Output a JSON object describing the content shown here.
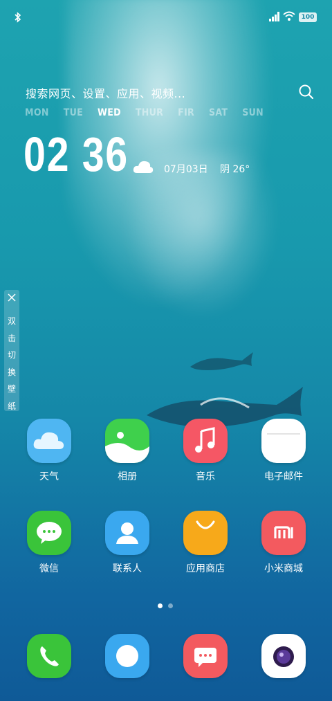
{
  "status_bar": {
    "battery": "100",
    "icons": [
      "bluetooth-icon",
      "signal-icon",
      "wifi-icon",
      "battery-icon"
    ]
  },
  "widget": {
    "search_placeholder": "搜索网页、设置、应用、视频...",
    "weekdays": [
      "MON",
      "TUE",
      "WED",
      "THUR",
      "FIR",
      "SAT",
      "SUN"
    ],
    "active_day": "WED",
    "time": "02 36",
    "date": "07月03日",
    "weather": "阴 26°"
  },
  "wallpaper_switch": {
    "label": [
      "双",
      "击",
      "切",
      "换",
      "壁",
      "纸"
    ]
  },
  "apps": [
    {
      "label": "天气",
      "color": "#4fb6f2"
    },
    {
      "label": "相册",
      "color": "#3fd04c"
    },
    {
      "label": "音乐",
      "color": "#f55765"
    },
    {
      "label": "电子邮件",
      "color": "#ffffff"
    },
    {
      "label": "微信",
      "color": "#3ac43a"
    },
    {
      "label": "联系人",
      "color": "#3aa8ef"
    },
    {
      "label": "应用商店",
      "color": "#f7a91a"
    },
    {
      "label": "小米商城",
      "color": "#f35a5f"
    }
  ],
  "page_indicator": {
    "pages": 2,
    "current": 1
  },
  "dock": [
    {
      "name": "phone",
      "color": "#3ac43a"
    },
    {
      "name": "browser",
      "color": "#3aa8ef"
    },
    {
      "name": "messages",
      "color": "#f35a5f"
    },
    {
      "name": "camera",
      "color": "#ffffff"
    }
  ]
}
